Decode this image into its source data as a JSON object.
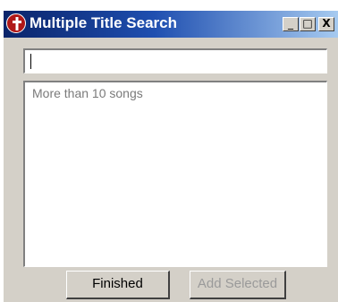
{
  "window": {
    "title": "Multiple Title Search",
    "controls": {
      "minimize": "_",
      "maximize": "□",
      "close": "X"
    }
  },
  "search": {
    "value": ""
  },
  "results": {
    "message": "More than 10 songs"
  },
  "buttons": {
    "finished": "Finished",
    "add_selected": "Add Selected"
  },
  "colors": {
    "titlebar_start": "#0a246a",
    "titlebar_end": "#a6caf0",
    "face": "#d4d0c8"
  },
  "icons": {
    "app": "cross-badge-icon"
  }
}
